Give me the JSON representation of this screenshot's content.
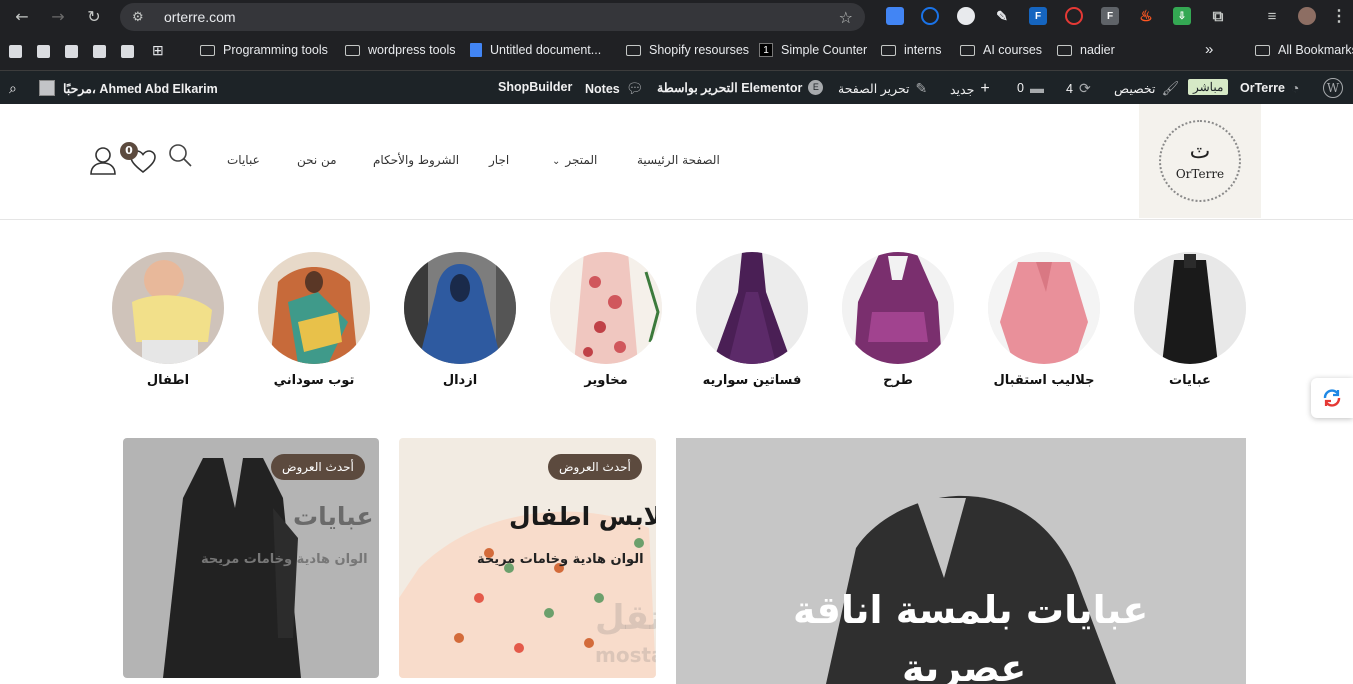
{
  "browser": {
    "url": "orterre.com",
    "bookmarks": [
      "Programming tools",
      "wordpress tools",
      "Untitled document...",
      "Shopify resourses",
      "Simple Counter",
      "interns",
      "AI courses",
      "nadier"
    ],
    "all_bookmarks": "All Bookmarks",
    "more_chevron": "»"
  },
  "wpbar": {
    "greeting": "مرحبًا، Ahmed Abd Elkarim",
    "shopbuilder": "ShopBuilder",
    "notes": "Notes",
    "elementor": "التحرير بواسطة Elementor",
    "edit_page": "تحرير الصفحة",
    "new": "جديد",
    "comments_count": "0",
    "updates_count": "4",
    "customize": "تخصيص",
    "live": "مباشر",
    "site_name": "OrTerre"
  },
  "header": {
    "logo_text": "OrTerre",
    "logo_mark": "ٽ",
    "menu": [
      "الصفحة الرئيسية",
      "المتجر",
      "اجار",
      "الشروط والأحكام",
      "من نحن",
      "عبايات"
    ],
    "wishlist_count": "0"
  },
  "categories": [
    {
      "label": "عبايات",
      "icon": "abaya-photo",
      "bg": "#e8e8e8",
      "fg": "#1a1a1a"
    },
    {
      "label": "جلاليب استقبال",
      "icon": "pink-jalabiya-photo",
      "bg": "#f4f4f4",
      "fg": "#e9909a"
    },
    {
      "label": "طرح",
      "icon": "purple-scarf-photo",
      "bg": "#f2f2f2",
      "fg": "#7a2f6e"
    },
    {
      "label": "فساتين سواريه",
      "icon": "purple-dress-photo",
      "bg": "#ececec",
      "fg": "#4a1f55"
    },
    {
      "label": "مخاوير",
      "icon": "floral-dress-photo",
      "bg": "#f5f0ea",
      "fg": "#d0575c"
    },
    {
      "label": "ازدال",
      "icon": "blue-isdal-photo",
      "bg": "#7d7d7d",
      "fg": "#2e5aa0"
    },
    {
      "label": "توب سوداني",
      "icon": "sudanese-toub-photo",
      "bg": "#e7d9c9",
      "fg": "#c76a3a"
    },
    {
      "label": "اطفال",
      "icon": "baby-photo",
      "bg": "#cfc3ba",
      "fg": "#f2e08a"
    }
  ],
  "banners": {
    "abayas": {
      "badge": "أحدث العروض",
      "title": "عبايات",
      "subtitle": "الوان هادية وخامات مريحة"
    },
    "kids": {
      "badge": "أحدث العروض",
      "title": "ملابس اطفال",
      "subtitle": "الوان هادية وخامات مريحة"
    },
    "hero": {
      "title_line1": "عبايات بلمسة اناقة",
      "title_line2": "عصرية"
    }
  },
  "watermark": {
    "text": "مستقل",
    "domain": "mostaql.com"
  }
}
